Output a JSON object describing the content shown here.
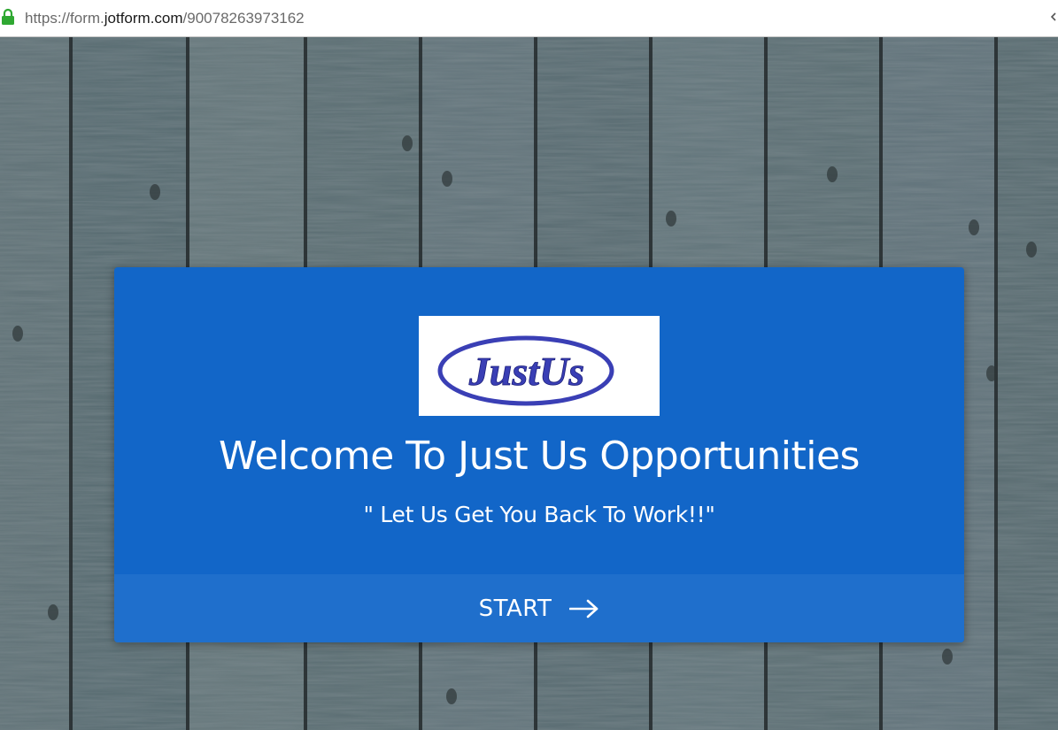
{
  "browser": {
    "url_scheme": "https://form.",
    "url_host": "jotform.com",
    "url_path": "/90078263973162",
    "lock_icon": "lock-icon",
    "lock_color": "#2fa832"
  },
  "background": {
    "description_icon": "wood-plank-background",
    "base_color": "#5d6f74"
  },
  "card": {
    "accent_color": "#1266c8",
    "start_bar_color": "#1f6fcc",
    "logo": {
      "text": "JustUs",
      "color": "#3a3fb5"
    },
    "title": "Welcome To Just Us Opportunities",
    "subtitle": "\" Let Us Get You Back To Work!!\"",
    "start_button": {
      "label": "START",
      "icon": "arrow-right-icon"
    }
  }
}
